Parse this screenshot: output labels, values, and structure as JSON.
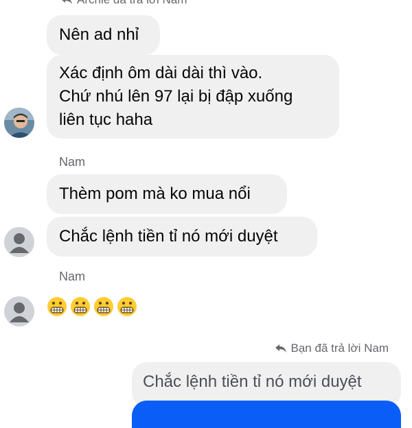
{
  "top_reply_note": "Archie đã trả lời Nam",
  "messages": [
    {
      "text": "Nên ad nhỉ"
    },
    {
      "lines": [
        "Xác định ôm dài dài thì vào.",
        "Chứ nhú lên 97 lại bị đập xuống",
        "liên tục haha"
      ]
    }
  ],
  "nam_group_1": {
    "sender": "Nam",
    "messages": [
      "Thèm pom mà ko mua nổi",
      "Chắc lệnh tiền tỉ nó mới duyệt"
    ]
  },
  "nam_group_2": {
    "sender": "Nam",
    "emojis": [
      "grimacing-face",
      "grimacing-face",
      "grimacing-face",
      "grimacing-face"
    ]
  },
  "self_reply": {
    "note": "Bạn đã trả lời Nam",
    "quoted": "Chắc lệnh tiền tỉ nó mới duyệt"
  },
  "colors": {
    "bubble_gray": "#f0f0f0",
    "self_bubble": "#0a5ef7",
    "meta_text": "#65676b"
  }
}
